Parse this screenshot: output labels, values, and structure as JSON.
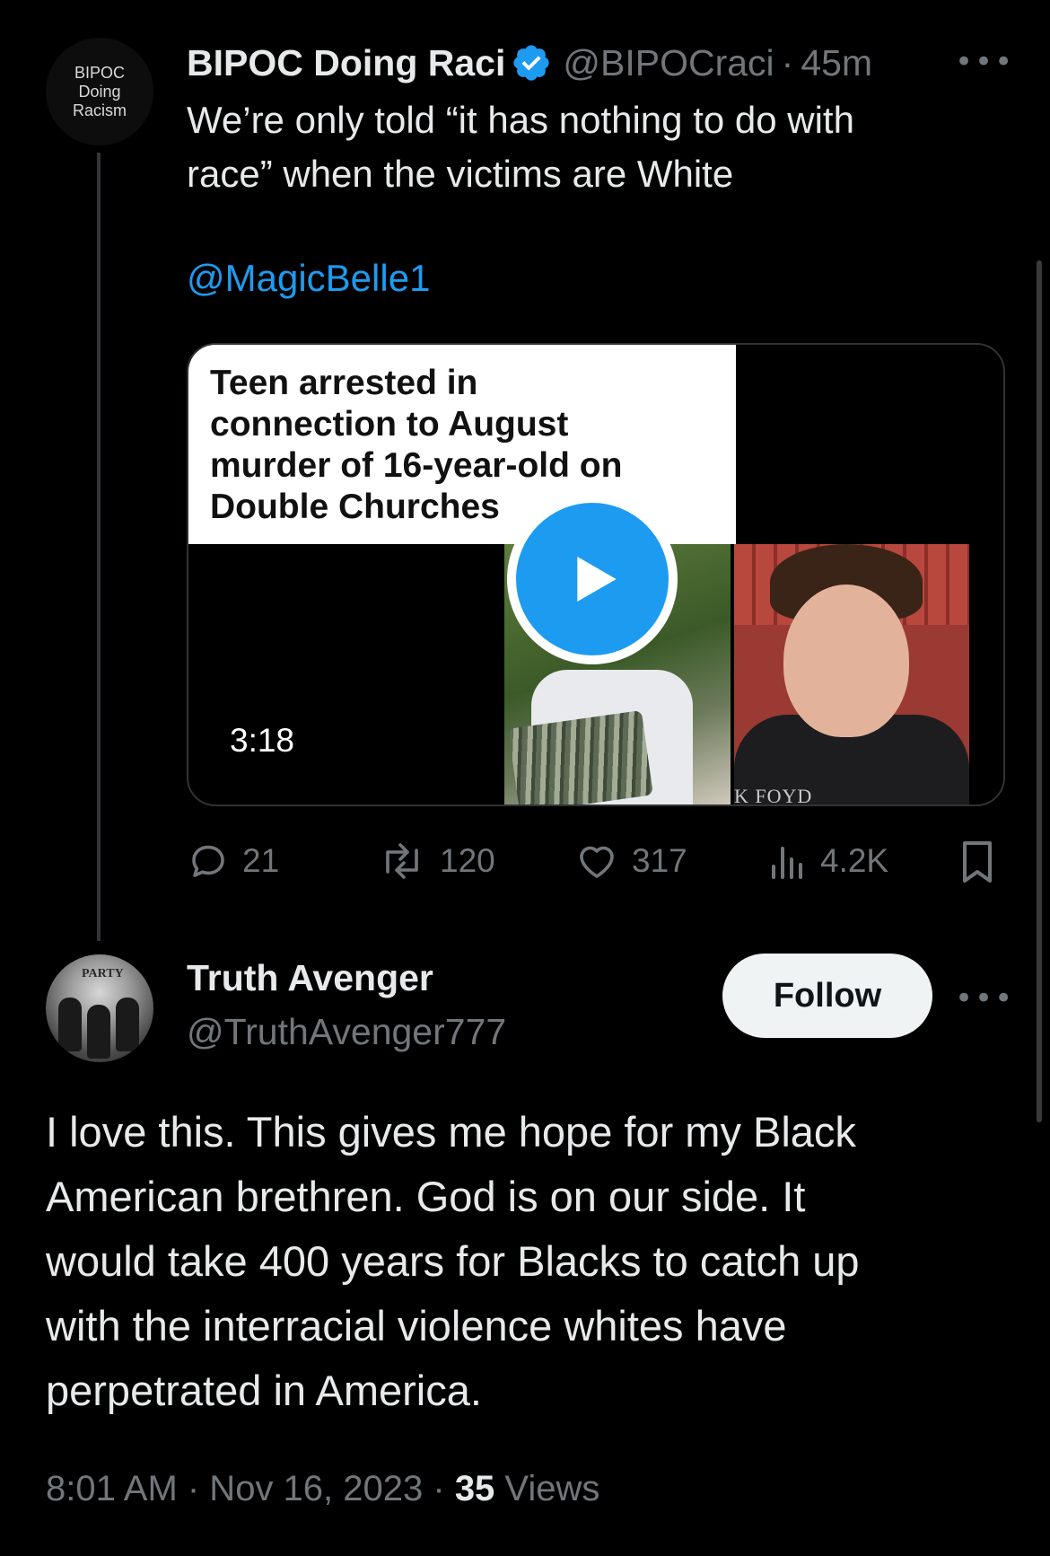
{
  "quoted_tweet": {
    "avatar_text": [
      "BIPOC",
      "Doing",
      "Racism"
    ],
    "display_name": "BIPOC Doing Raci",
    "handle": "@BIPOCraci",
    "separator": "·",
    "time": "45m",
    "more": "•••",
    "text": "We’re only told “it has nothing to do with\nrace” when the victims are White",
    "mention": "@MagicBelle1",
    "media": {
      "headline": "Teen arrested in\nconnection to August\nmurder of 16-year-old on\nDouble Churches",
      "duration": "3:18",
      "photo_caption": "K FOYD"
    },
    "actions": {
      "replies": "21",
      "reposts": "120",
      "likes": "317",
      "views": "4.2K"
    }
  },
  "reply_tweet": {
    "display_name": "Truth Avenger",
    "handle": "@TruthAvenger777",
    "follow_label": "Follow",
    "more": "•••",
    "avatar_sign": "PARTY",
    "text": "I love this. This gives me hope for my Black\nAmerican brethren. God is on our side. It\nwould take 400 years for Blacks to catch up\nwith the interracial violence whites have\nperpetrated in America.",
    "timestamp": "8:01 AM · Nov 16, 2023 · ",
    "views_count": "35",
    "views_label": " Views"
  },
  "colors": {
    "background": "#000000",
    "text_primary": "#e7e9ea",
    "text_secondary": "#71767b",
    "accent_blue": "#1d9bf0",
    "follow_button_bg": "#eff3f4"
  },
  "icons": [
    "verified-badge-icon",
    "reply-icon",
    "repost-icon",
    "like-icon",
    "views-icon",
    "bookmark-icon",
    "play-icon",
    "more-icon"
  ]
}
